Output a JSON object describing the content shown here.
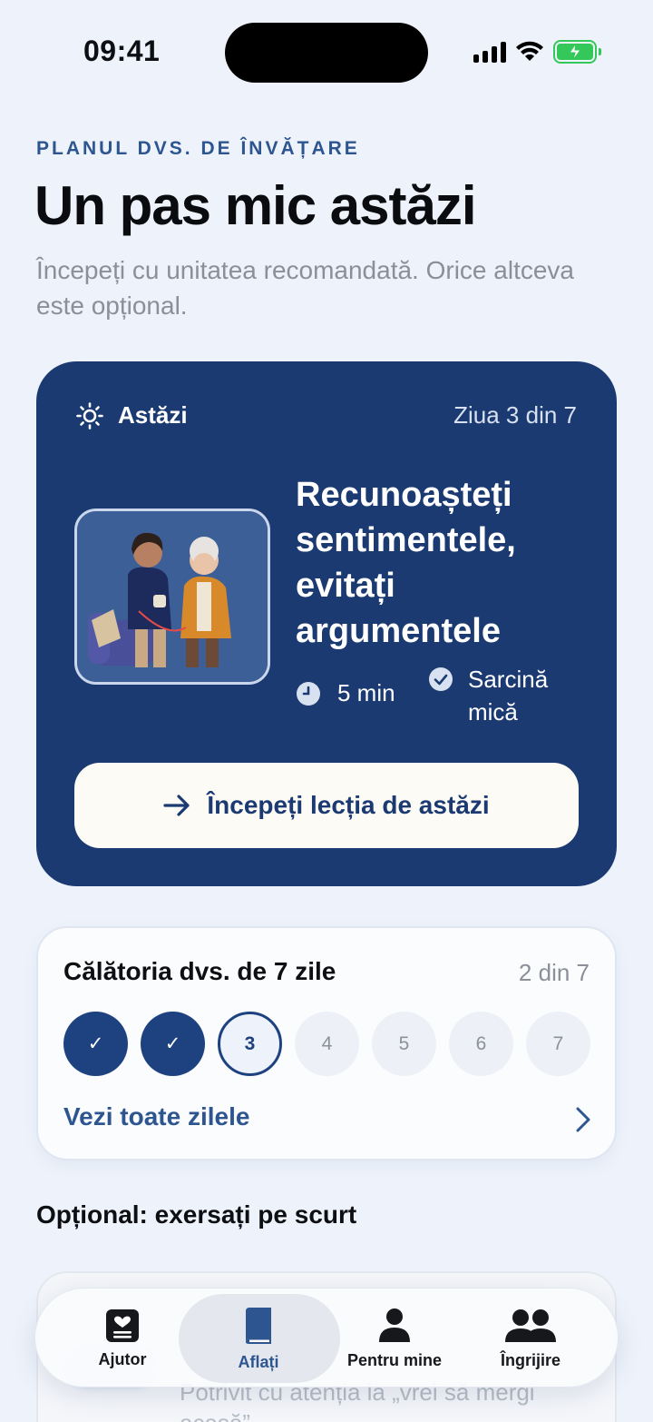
{
  "status_bar": {
    "time": "09:41"
  },
  "header": {
    "eyebrow": "PLANUL DVS. DE ÎNVĂȚARE",
    "title": "Un pas mic astăzi",
    "subtitle": "Începeți cu unitatea recomandată. Orice altceva este opțional."
  },
  "today_card": {
    "label": "Astăzi",
    "day_count": "Ziua 3 din 7",
    "lesson_title": "Recunoașteți sentimentele, evitați argumentele",
    "duration": "5 min",
    "task": "Sarcină mică",
    "start_button": "Începeți lecția de astăzi",
    "colors": {
      "background": "#1b3a72",
      "button": "#fdfbf6"
    }
  },
  "journey": {
    "title": "Călătoria dvs. de 7 zile",
    "progress": "2 din 7",
    "days": [
      {
        "label": "✓",
        "state": "done"
      },
      {
        "label": "✓",
        "state": "done"
      },
      {
        "label": "3",
        "state": "current"
      },
      {
        "label": "4",
        "state": "upcoming"
      },
      {
        "label": "5",
        "state": "upcoming"
      },
      {
        "label": "6",
        "state": "upcoming"
      },
      {
        "label": "7",
        "state": "upcoming"
      }
    ],
    "see_all": "Vezi toate zilele"
  },
  "optional": {
    "title": "Opțional: exersați pe scurt",
    "card_description": "Potrivit cu atenția la „vrei să mergi acasă”"
  },
  "tab_bar": {
    "tabs": [
      {
        "label": "Ajutor",
        "icon": "heart-card-icon",
        "active": false
      },
      {
        "label": "Aflați",
        "icon": "book-icon",
        "active": true
      },
      {
        "label": "Pentru mine",
        "icon": "person-icon",
        "active": false
      },
      {
        "label": "Îngrijire",
        "icon": "people-icon",
        "active": false
      }
    ]
  }
}
